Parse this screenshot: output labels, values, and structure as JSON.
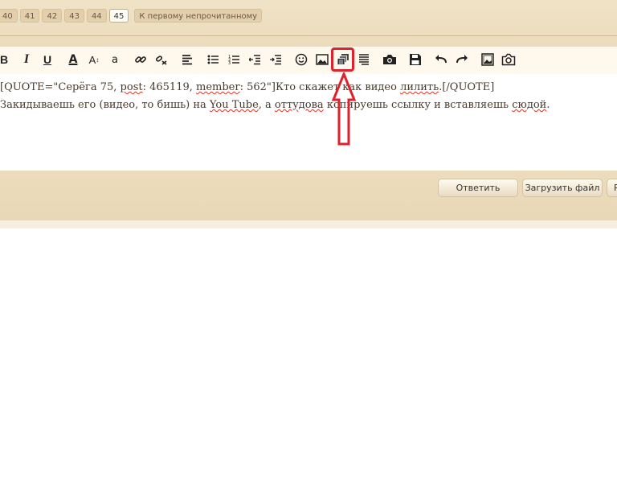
{
  "pagination": {
    "pages": [
      "40",
      "41",
      "42",
      "43",
      "44",
      "45"
    ],
    "current": "45",
    "first_unread": "К первому непрочитанному"
  },
  "toolbar": {
    "bold": "B",
    "italic": "I",
    "underline": "U",
    "font_color": "A",
    "font_size": "A",
    "font_family": "a"
  },
  "editor": {
    "line1": {
      "a": "[QUOTE=\"Серёга 75, ",
      "b": "post",
      "c": ": 465119, ",
      "d": "member",
      "e": ": 562\"]Кто скажет как видео ",
      "f": "лилить",
      "g": ".[/QUOTE]"
    },
    "line2": {
      "a": "Закидываешь его (видео, то бишь) на ",
      "b": "You Tube",
      "c": ", а ",
      "d": "оттудова",
      "e": " копируешь ссылку и вставляешь ",
      "f": "сюдой",
      "g": "."
    }
  },
  "buttons": {
    "reply": "Ответить",
    "upload": "Загрузить файл",
    "preview": "Р"
  },
  "annotation": {
    "color": "#e0202a"
  }
}
